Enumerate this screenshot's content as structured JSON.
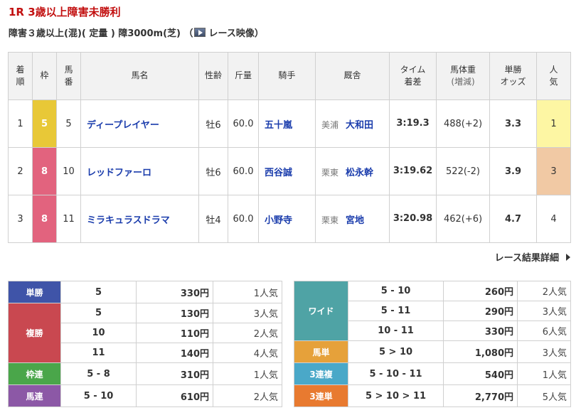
{
  "race": {
    "title": "1R 3歳以上障害未勝利",
    "conditions": "障害３歳以上(混)( 定量 ) 障3000m(芝) （",
    "video_label": "レース映像",
    "conditions_close": "）"
  },
  "results": {
    "headers": {
      "rank": [
        "着",
        "順"
      ],
      "waku": "枠",
      "umaban": [
        "馬",
        "番"
      ],
      "horse": "馬名",
      "sexage": "性齢",
      "weight": "斤量",
      "jockey": "騎手",
      "trainer": "厩舎",
      "time": [
        "タイム",
        "着差"
      ],
      "body": [
        "馬体重",
        "(増減)"
      ],
      "odds": [
        "単勝",
        "オッズ"
      ],
      "pop": [
        "人",
        "気"
      ]
    },
    "rows": [
      {
        "rank": "1",
        "waku": "5",
        "umaban": "5",
        "horse": "ディープレイヤー",
        "sexage": "牡6",
        "weight": "60.0",
        "jockey": "五十嵐",
        "area": "美浦",
        "trainer": "大和田",
        "time": "3:19.3",
        "body": "488(+2)",
        "odds": "3.3",
        "pop": "1"
      },
      {
        "rank": "2",
        "waku": "8",
        "umaban": "10",
        "horse": "レッドファーロ",
        "sexage": "牡6",
        "weight": "60.0",
        "jockey": "西谷誠",
        "area": "栗東",
        "trainer": "松永幹",
        "time": "3:19.62",
        "body": "522(-2)",
        "odds": "3.9",
        "pop": "3"
      },
      {
        "rank": "3",
        "waku": "8",
        "umaban": "11",
        "horse": "ミラキュラスドラマ",
        "sexage": "牡4",
        "weight": "60.0",
        "jockey": "小野寺",
        "area": "栗東",
        "trainer": "宮地",
        "time": "3:20.98",
        "body": "462(+6)",
        "odds": "4.7",
        "pop": "4"
      }
    ]
  },
  "more_link": "レース結果詳細",
  "payouts": {
    "tansho": {
      "label": "単勝",
      "color": "#3f54a8",
      "rows": [
        {
          "num": "5",
          "yen": "330円",
          "ninki": "1人気"
        }
      ]
    },
    "fukusho": {
      "label": "複勝",
      "color": "#c94850",
      "rows": [
        {
          "num": "5",
          "yen": "130円",
          "ninki": "3人気"
        },
        {
          "num": "10",
          "yen": "110円",
          "ninki": "2人気"
        },
        {
          "num": "11",
          "yen": "140円",
          "ninki": "4人気"
        }
      ]
    },
    "wakuren": {
      "label": "枠連",
      "color": "#4aa64a",
      "rows": [
        {
          "num": "5 - 8",
          "yen": "310円",
          "ninki": "1人気"
        }
      ]
    },
    "umaren": {
      "label": "馬連",
      "color": "#8c58a6",
      "rows": [
        {
          "num": "5 - 10",
          "yen": "610円",
          "ninki": "2人気"
        }
      ]
    },
    "wide": {
      "label": "ワイド",
      "color": "#4fa3a5",
      "rows": [
        {
          "num": "5 - 10",
          "yen": "260円",
          "ninki": "2人気"
        },
        {
          "num": "5 - 11",
          "yen": "290円",
          "ninki": "3人気"
        },
        {
          "num": "10 - 11",
          "yen": "330円",
          "ninki": "6人気"
        }
      ]
    },
    "umatan": {
      "label": "馬単",
      "color": "#e6a13a",
      "rows": [
        {
          "num": "5 > 10",
          "yen": "1,080円",
          "ninki": "3人気"
        }
      ]
    },
    "sanrenpuku": {
      "label": "3連複",
      "color": "#4aa8c8",
      "rows": [
        {
          "num": "5 - 10 - 11",
          "yen": "540円",
          "ninki": "1人気"
        }
      ]
    },
    "sanrentan": {
      "label": "3連単",
      "color": "#e87a30",
      "rows": [
        {
          "num": "5 > 10 > 11",
          "yen": "2,770円",
          "ninki": "5人気"
        }
      ]
    }
  }
}
